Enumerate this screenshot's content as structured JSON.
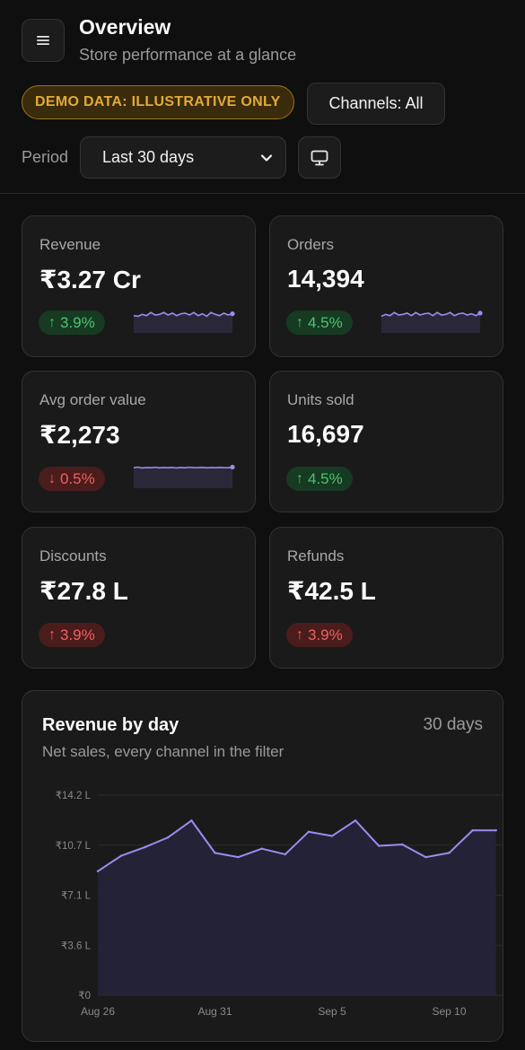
{
  "header": {
    "title": "Overview",
    "subtitle": "Store performance at a glance",
    "demo_badge": "DEMO DATA: ILLUSTRATIVE ONLY",
    "channels_button": "Channels: All",
    "period_label": "Period",
    "period_value": "Last 30 days"
  },
  "kpis": [
    {
      "label": "Revenue",
      "value": "₹3.27 Cr",
      "change": "3.9%",
      "direction": "up",
      "sentiment": "good",
      "has_sparkline": true
    },
    {
      "label": "Orders",
      "value": "14,394",
      "change": "4.5%",
      "direction": "up",
      "sentiment": "good",
      "has_sparkline": true
    },
    {
      "label": "Avg order value",
      "value": "₹2,273",
      "change": "0.5%",
      "direction": "down",
      "sentiment": "bad",
      "has_sparkline": true
    },
    {
      "label": "Units sold",
      "value": "16,697",
      "change": "4.5%",
      "direction": "up",
      "sentiment": "good",
      "has_sparkline": false
    },
    {
      "label": "Discounts",
      "value": "₹27.8 L",
      "change": "3.9%",
      "direction": "up",
      "sentiment": "bad",
      "has_sparkline": false
    },
    {
      "label": "Refunds",
      "value": "₹42.5 L",
      "change": "3.9%",
      "direction": "up",
      "sentiment": "bad",
      "has_sparkline": false
    }
  ],
  "revenue_chart": {
    "title": "Revenue by day",
    "range_label": "30 days",
    "subtitle": "Net sales, every channel in the filter"
  },
  "colors": {
    "accent": "#9b8cf0",
    "good": "#4cc46e",
    "bad": "#f06060",
    "warning": "#e2aa3a"
  },
  "chart_data": {
    "type": "area",
    "x": [
      "Aug 26",
      "Aug 27",
      "Aug 28",
      "Aug 29",
      "Aug 30",
      "Aug 31",
      "Sep 1",
      "Sep 2",
      "Sep 3",
      "Sep 4",
      "Sep 5",
      "Sep 6",
      "Sep 7",
      "Sep 8",
      "Sep 9",
      "Sep 10",
      "Sep 11",
      "Sep 12"
    ],
    "series": [
      {
        "values": [
          8.8,
          9.9,
          10.5,
          11.2,
          12.4,
          10.1,
          9.8,
          10.4,
          10.0,
          11.6,
          11.3,
          12.4,
          10.6,
          10.7,
          9.8,
          10.1,
          11.7,
          11.7
        ]
      }
    ],
    "x_tick_labels": [
      "Aug 26",
      "Aug 31",
      "Sep 5",
      "Sep 10"
    ],
    "y_tick_labels": [
      "₹0",
      "₹3.6 L",
      "₹7.1 L",
      "₹10.7 L",
      "₹14.2 L"
    ],
    "ylabel": "",
    "xlabel": "",
    "ylim": [
      0,
      14.2
    ],
    "y_unit": "₹ L",
    "grid": true
  }
}
